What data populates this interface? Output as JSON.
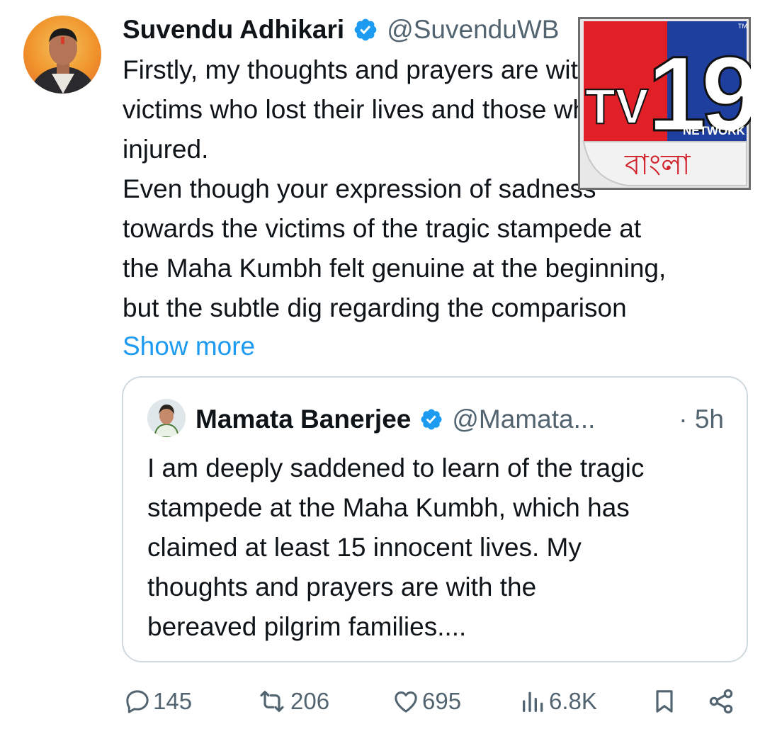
{
  "tweet": {
    "author_name": "Suvendu Adhikari",
    "author_handle": "@SuvenduWB",
    "lines": [
      "Firstly, my thoughts and prayers are with the",
      "victims who lost their lives and those who were",
      "injured.",
      "Even though your expression of sadness",
      "towards the victims of the tragic stampede at",
      "the Maha Kumbh felt genuine at the beginning,",
      "but the subtle dig regarding the comparison"
    ],
    "show_more": "Show more"
  },
  "quote": {
    "author_name": "Mamata Banerjee",
    "author_handle": "@Mamata...",
    "time": "· 5h",
    "lines": [
      "I am deeply saddened to learn of the tragic",
      "stampede at the Maha Kumbh, which has",
      "claimed at least 15 innocent lives. My",
      "thoughts and prayers are with the",
      "bereaved pilgrim families...."
    ]
  },
  "actions": {
    "replies": "145",
    "reposts": "206",
    "likes": "695",
    "views": "6.8K"
  },
  "watermark": {
    "brand": "TV19",
    "network": "NETWORK",
    "tm": "TM",
    "language": "বাংলা"
  },
  "icons": [
    "verified-badge-icon",
    "reply-icon",
    "repost-icon",
    "like-icon",
    "views-icon",
    "bookmark-icon",
    "share-icon"
  ],
  "colors": {
    "accent": "#1d9bf0",
    "muted": "#536471",
    "border": "#cfd9de",
    "logo_red": "#e01f26",
    "logo_blue": "#1f3f9f"
  }
}
